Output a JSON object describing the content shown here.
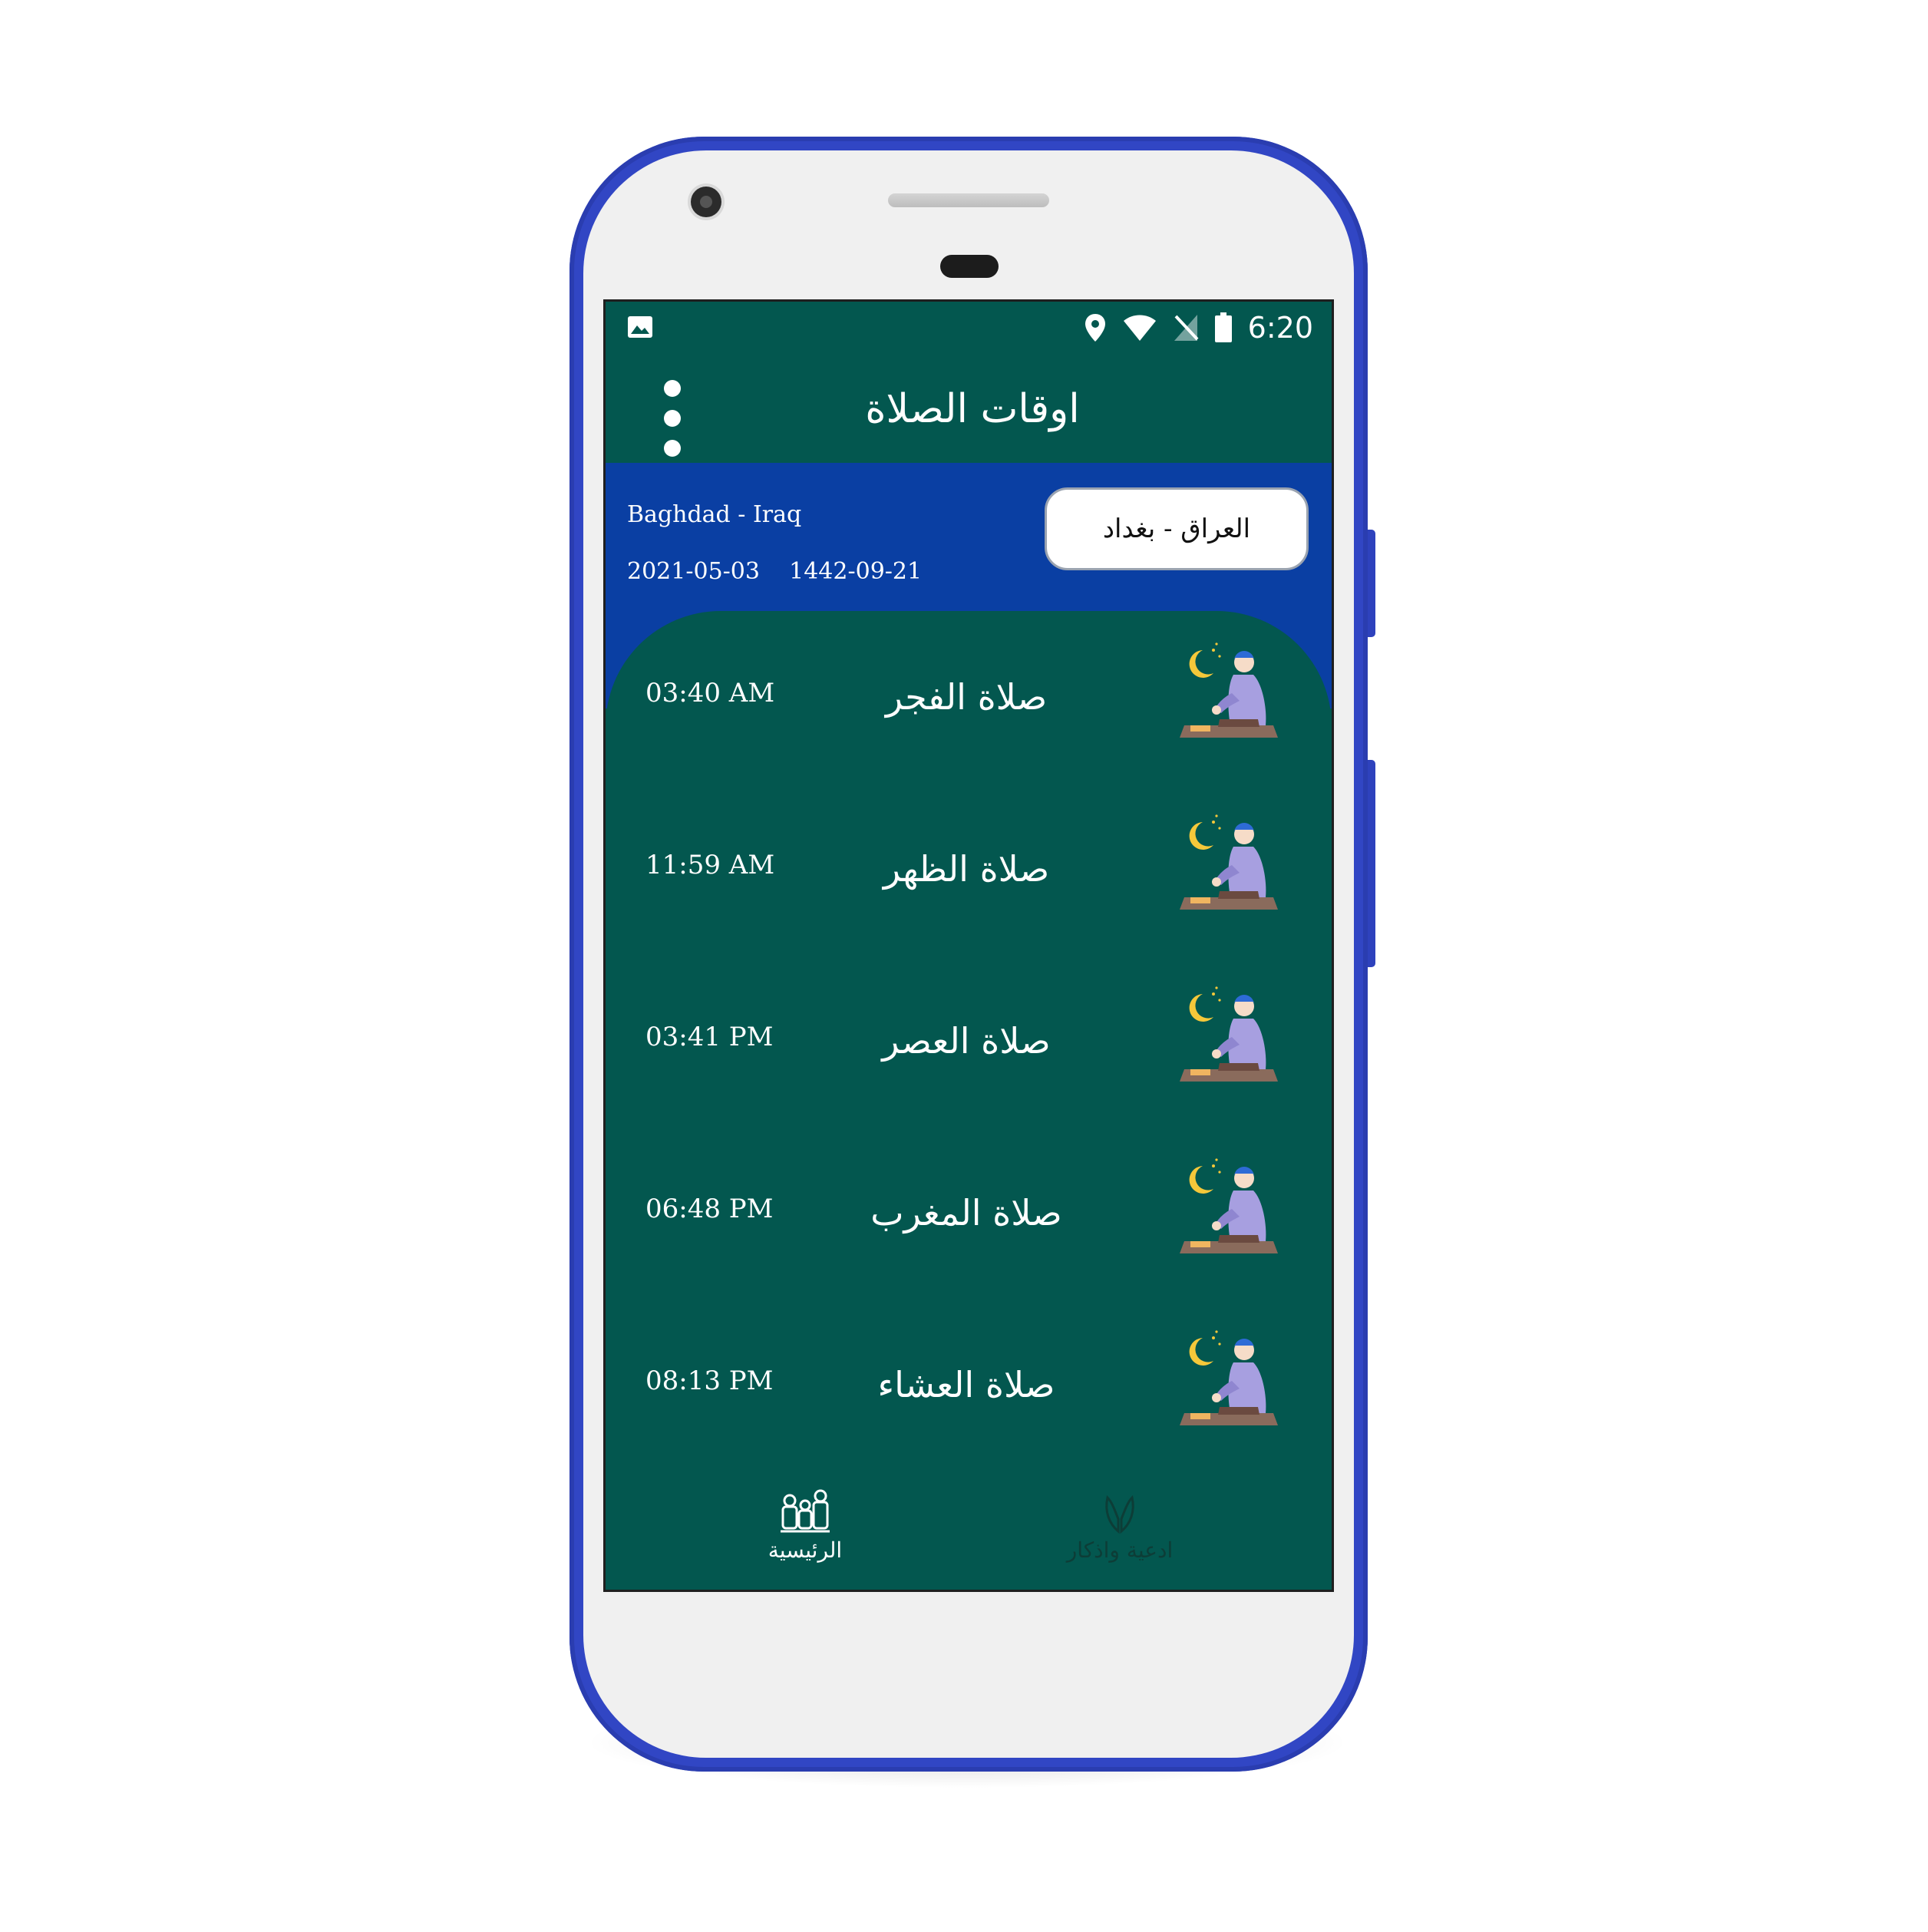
{
  "status_bar": {
    "time": "6:20",
    "icons": [
      "image-icon",
      "location-pin-icon",
      "wifi-icon",
      "no-signal-icon",
      "battery-icon"
    ]
  },
  "toolbar": {
    "title": "اوقات الصلاة",
    "menu_icon": "overflow-menu-icon"
  },
  "location": {
    "english": "Baghdad - Iraq",
    "gregorian_date": "2021-05-03",
    "hijri_date": "1442-09-21",
    "city_button": "العراق - بغداد"
  },
  "prayers": [
    {
      "name": "صلاة الفجر",
      "time": "03:40 AM",
      "icon": "praying-man-moon-icon"
    },
    {
      "name": "صلاة الظهر",
      "time": "11:59 AM",
      "icon": "praying-man-moon-icon"
    },
    {
      "name": "صلاة العصر",
      "time": "03:41 PM",
      "icon": "praying-man-moon-icon"
    },
    {
      "name": "صلاة المغرب",
      "time": "06:48 PM",
      "icon": "praying-man-moon-icon"
    },
    {
      "name": "صلاة العشاء",
      "time": "08:13 PM",
      "icon": "praying-man-moon-icon"
    }
  ],
  "bottom_nav": {
    "home_label": "الرئيسية",
    "duas_label": "ادعية واذكار",
    "active": "home"
  },
  "colors": {
    "screen_bg": "#03574f",
    "location_bg": "#0a3fa3",
    "phone_frame": "#3146c4"
  }
}
